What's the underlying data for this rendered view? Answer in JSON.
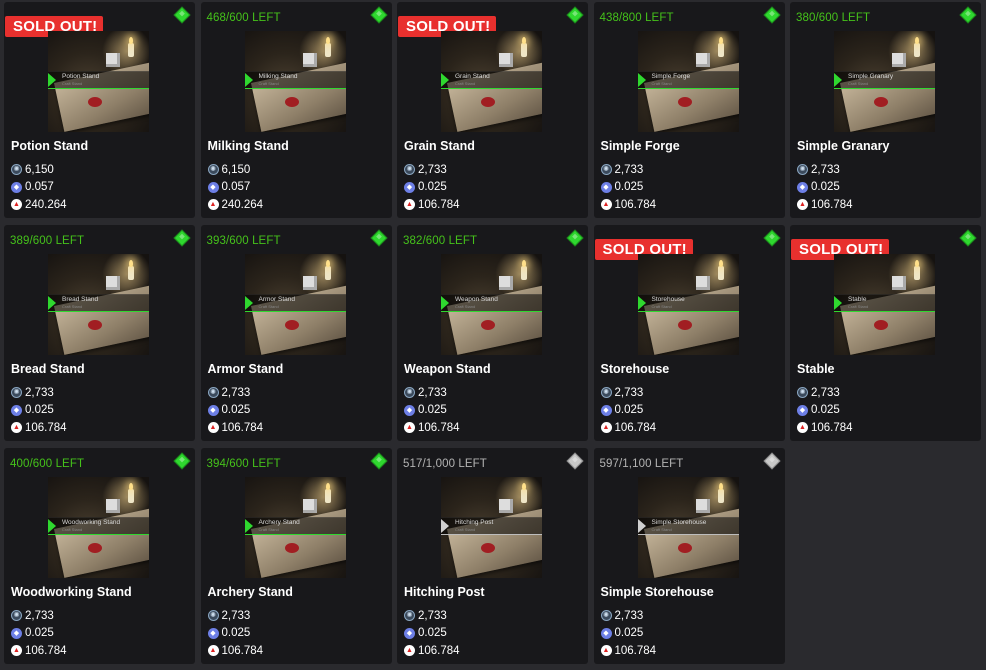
{
  "sold_out_label": "SOLD OUT!",
  "colors": {
    "accent_green": "#2fd82f",
    "stock_green": "#45c21b",
    "sold_red": "#e8302e",
    "card_bg": "#18181b"
  },
  "icons": {
    "rarity": "diamond-gem-icon",
    "price1": "wax-coin-icon",
    "price2": "eth-coin-icon",
    "price3": "triangle-token-icon"
  },
  "cards": [
    {
      "name": "Potion Stand",
      "thumb_title": "Potion Stand",
      "thumb_sub": "Craft Stand",
      "stock": "",
      "sold_out": true,
      "tier": "green",
      "price1": "6,150",
      "price2": "0.057",
      "price3": "240.264"
    },
    {
      "name": "Milking Stand",
      "thumb_title": "Milking Stand",
      "thumb_sub": "Craft Stand",
      "stock": "468/600 LEFT",
      "sold_out": false,
      "tier": "green",
      "price1": "6,150",
      "price2": "0.057",
      "price3": "240.264"
    },
    {
      "name": "Grain Stand",
      "thumb_title": "Grain Stand",
      "thumb_sub": "Craft Stand",
      "stock": "",
      "sold_out": true,
      "tier": "green",
      "price1": "2,733",
      "price2": "0.025",
      "price3": "106.784"
    },
    {
      "name": "Simple Forge",
      "thumb_title": "Simple Forge",
      "thumb_sub": "Craft Stand",
      "stock": "438/800 LEFT",
      "sold_out": false,
      "tier": "green",
      "price1": "2,733",
      "price2": "0.025",
      "price3": "106.784"
    },
    {
      "name": "Simple Granary",
      "thumb_title": "Simple Granary",
      "thumb_sub": "Craft Stand",
      "stock": "380/600 LEFT",
      "sold_out": false,
      "tier": "green",
      "price1": "2,733",
      "price2": "0.025",
      "price3": "106.784"
    },
    {
      "name": "Bread Stand",
      "thumb_title": "Bread Stand",
      "thumb_sub": "Craft Stand",
      "stock": "389/600 LEFT",
      "sold_out": false,
      "tier": "green",
      "price1": "2,733",
      "price2": "0.025",
      "price3": "106.784"
    },
    {
      "name": "Armor Stand",
      "thumb_title": "Armor Stand",
      "thumb_sub": "Craft Stand",
      "stock": "393/600 LEFT",
      "sold_out": false,
      "tier": "green",
      "price1": "2,733",
      "price2": "0.025",
      "price3": "106.784"
    },
    {
      "name": "Weapon Stand",
      "thumb_title": "Weapon Stand",
      "thumb_sub": "Craft Stand",
      "stock": "382/600 LEFT",
      "sold_out": false,
      "tier": "green",
      "price1": "2,733",
      "price2": "0.025",
      "price3": "106.784"
    },
    {
      "name": "Storehouse",
      "thumb_title": "Storehouse",
      "thumb_sub": "Craft Stand",
      "stock": "",
      "sold_out": true,
      "tier": "green",
      "price1": "2,733",
      "price2": "0.025",
      "price3": "106.784"
    },
    {
      "name": "Stable",
      "thumb_title": "Stable",
      "thumb_sub": "Craft Stand",
      "stock": "",
      "sold_out": true,
      "tier": "green",
      "price1": "2,733",
      "price2": "0.025",
      "price3": "106.784"
    },
    {
      "name": "Woodworking Stand",
      "thumb_title": "Woodworking Stand",
      "thumb_sub": "Craft Stand",
      "stock": "400/600 LEFT",
      "sold_out": false,
      "tier": "green",
      "price1": "2,733",
      "price2": "0.025",
      "price3": "106.784"
    },
    {
      "name": "Archery Stand",
      "thumb_title": "Archery Stand",
      "thumb_sub": "Craft Stand",
      "stock": "394/600 LEFT",
      "sold_out": false,
      "tier": "green",
      "price1": "2,733",
      "price2": "0.025",
      "price3": "106.784"
    },
    {
      "name": "Hitching Post",
      "thumb_title": "Hitching Post",
      "thumb_sub": "Craft Stand",
      "stock": "517/1,000 LEFT",
      "sold_out": false,
      "tier": "gray",
      "price1": "2,733",
      "price2": "0.025",
      "price3": "106.784"
    },
    {
      "name": "Simple Storehouse",
      "thumb_title": "Simple Storehouse",
      "thumb_sub": "Craft Stand",
      "stock": "597/1,100 LEFT",
      "sold_out": false,
      "tier": "gray",
      "price1": "2,733",
      "price2": "0.025",
      "price3": "106.784"
    }
  ]
}
